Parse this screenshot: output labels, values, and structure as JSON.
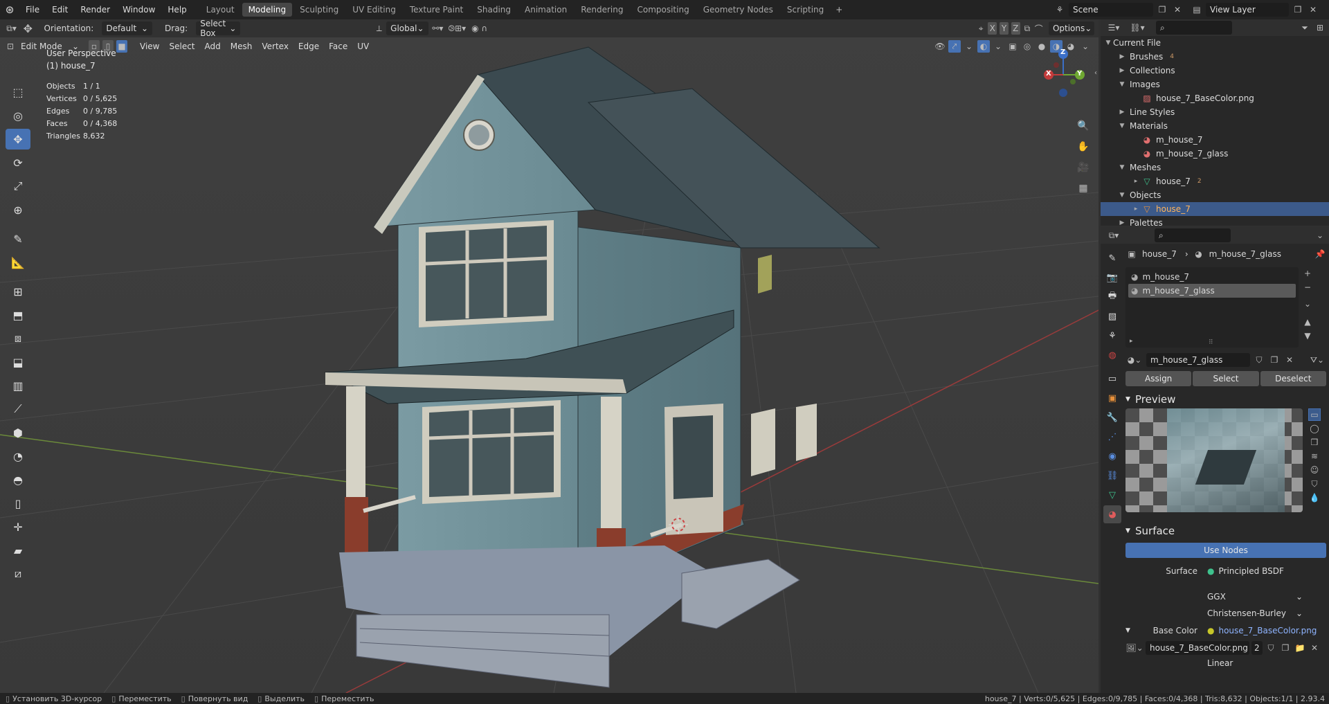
{
  "menus": [
    "File",
    "Edit",
    "Render",
    "Window",
    "Help"
  ],
  "workspaces": [
    "Layout",
    "Modeling",
    "Sculpting",
    "UV Editing",
    "Texture Paint",
    "Shading",
    "Animation",
    "Rendering",
    "Compositing",
    "Geometry Nodes",
    "Scripting"
  ],
  "active_workspace": "Modeling",
  "scene": "Scene",
  "view_layer": "View Layer",
  "header": {
    "orientation_label": "Orientation:",
    "orientation_value": "Default",
    "drag_label": "Drag:",
    "drag_value": "Select Box",
    "transform": "Global",
    "options": "Options",
    "mode": "Edit Mode",
    "view_menus": [
      "View",
      "Select",
      "Add",
      "Mesh",
      "Vertex",
      "Edge",
      "Face",
      "UV"
    ]
  },
  "overlay_info": {
    "view": "User Perspective",
    "object": "(1) house_7",
    "stats": [
      [
        "Objects",
        "1 / 1"
      ],
      [
        "Vertices",
        "0 / 5,625"
      ],
      [
        "Edges",
        "0 / 9,785"
      ],
      [
        "Faces",
        "0 / 4,368"
      ],
      [
        "Triangles",
        "8,632"
      ]
    ]
  },
  "gizmo": {
    "x": "X",
    "y": "Y",
    "z": "Z"
  },
  "outliner": {
    "root": "Current File",
    "rows": [
      {
        "label": "Brushes",
        "level": 1,
        "open": false,
        "badge": "4"
      },
      {
        "label": "Collections",
        "level": 1,
        "open": false
      },
      {
        "label": "Images",
        "level": 1,
        "open": true
      },
      {
        "label": "house_7_BaseColor.png",
        "level": 2,
        "icon": "image"
      },
      {
        "label": "Line Styles",
        "level": 1,
        "open": false
      },
      {
        "label": "Materials",
        "level": 1,
        "open": true
      },
      {
        "label": "m_house_7",
        "level": 2,
        "icon": "material"
      },
      {
        "label": "m_house_7_glass",
        "level": 2,
        "icon": "material"
      },
      {
        "label": "Meshes",
        "level": 1,
        "open": true
      },
      {
        "label": "house_7",
        "level": 2,
        "icon": "mesh",
        "badge": "2"
      },
      {
        "label": "Objects",
        "level": 1,
        "open": true
      },
      {
        "label": "house_7",
        "level": 2,
        "icon": "object",
        "selected": true
      },
      {
        "label": "Palettes",
        "level": 1,
        "open": false
      }
    ]
  },
  "props": {
    "breadcrumb_obj": "house_7",
    "breadcrumb_mat": "m_house_7_glass",
    "slots": [
      "m_house_7",
      "m_house_7_glass"
    ],
    "active_material": "m_house_7_glass",
    "assign": "Assign",
    "select": "Select",
    "deselect": "Deselect",
    "preview": "Preview",
    "surface": "Surface",
    "use_nodes": "Use Nodes",
    "surface_label": "Surface",
    "surface_value": "Principled BSDF",
    "distribution": "GGX",
    "subsurface": "Christensen-Burley",
    "base_color_label": "Base Color",
    "base_color_value": "house_7_BaseColor.png",
    "image_name": "house_7_BaseColor.png",
    "image_users": "2",
    "interp": "Linear"
  },
  "status": {
    "left": [
      [
        "Установить 3D-курсор",
        "Переместить"
      ],
      [
        "Повернуть вид"
      ],
      [
        "Выделить",
        "Переместить"
      ]
    ],
    "right": "house_7 | Verts:0/5,625 | Edges:0/9,785 | Faces:0/4,368 | Tris:8,632 | Objects:1/1 | 2.93.4"
  },
  "colors": {
    "accent": "#4772b3",
    "selected_row": "#3c5a8a",
    "house_wall": "#6f8e96",
    "roof": "#3b4a50",
    "brick": "#8a3d2c"
  }
}
